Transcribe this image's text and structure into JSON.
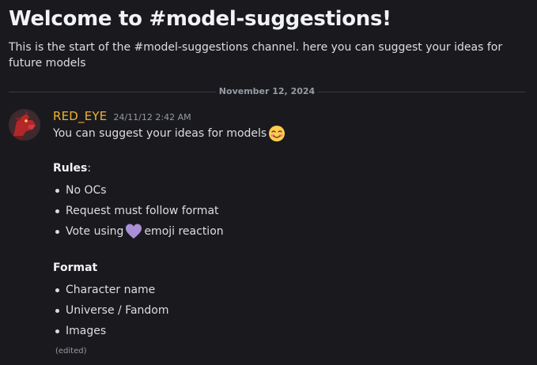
{
  "channel": {
    "title": "Welcome to #model-suggestions!",
    "description": "This is the start of the #model-suggestions channel. here you can suggest your ideas for future models"
  },
  "divider": {
    "date": "November 12, 2024"
  },
  "message": {
    "author": "RED_EYE",
    "author_color": "#f0b232",
    "timestamp": "24/11/12 2:42 AM",
    "intro": "You can suggest your ideas for models",
    "intro_emoji": "smiling-blushing-face-emoji",
    "rules_heading": "Rules",
    "rules_colon": ":",
    "rules": {
      "item0": "No OCs",
      "item1": "Request must follow format",
      "item2_before": "Vote using",
      "item2_emoji": "purple-heart-emoji",
      "item2_after": "emoji reaction"
    },
    "format_heading": "Format",
    "format": {
      "item0": "Character name",
      "item1": "Universe / Fandom",
      "item2": "Images"
    },
    "edited_label": "(edited)"
  }
}
